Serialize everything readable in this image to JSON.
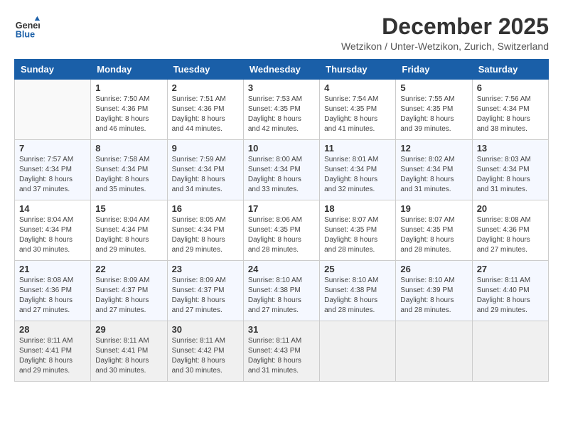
{
  "logo": {
    "general": "General",
    "blue": "Blue"
  },
  "title": "December 2025",
  "location": "Wetzikon / Unter-Wetzikon, Zurich, Switzerland",
  "weekdays": [
    "Sunday",
    "Monday",
    "Tuesday",
    "Wednesday",
    "Thursday",
    "Friday",
    "Saturday"
  ],
  "weeks": [
    [
      {
        "day": "",
        "content": ""
      },
      {
        "day": "1",
        "content": "Sunrise: 7:50 AM\nSunset: 4:36 PM\nDaylight: 8 hours\nand 46 minutes."
      },
      {
        "day": "2",
        "content": "Sunrise: 7:51 AM\nSunset: 4:36 PM\nDaylight: 8 hours\nand 44 minutes."
      },
      {
        "day": "3",
        "content": "Sunrise: 7:53 AM\nSunset: 4:35 PM\nDaylight: 8 hours\nand 42 minutes."
      },
      {
        "day": "4",
        "content": "Sunrise: 7:54 AM\nSunset: 4:35 PM\nDaylight: 8 hours\nand 41 minutes."
      },
      {
        "day": "5",
        "content": "Sunrise: 7:55 AM\nSunset: 4:35 PM\nDaylight: 8 hours\nand 39 minutes."
      },
      {
        "day": "6",
        "content": "Sunrise: 7:56 AM\nSunset: 4:34 PM\nDaylight: 8 hours\nand 38 minutes."
      }
    ],
    [
      {
        "day": "7",
        "content": "Sunrise: 7:57 AM\nSunset: 4:34 PM\nDaylight: 8 hours\nand 37 minutes."
      },
      {
        "day": "8",
        "content": "Sunrise: 7:58 AM\nSunset: 4:34 PM\nDaylight: 8 hours\nand 35 minutes."
      },
      {
        "day": "9",
        "content": "Sunrise: 7:59 AM\nSunset: 4:34 PM\nDaylight: 8 hours\nand 34 minutes."
      },
      {
        "day": "10",
        "content": "Sunrise: 8:00 AM\nSunset: 4:34 PM\nDaylight: 8 hours\nand 33 minutes."
      },
      {
        "day": "11",
        "content": "Sunrise: 8:01 AM\nSunset: 4:34 PM\nDaylight: 8 hours\nand 32 minutes."
      },
      {
        "day": "12",
        "content": "Sunrise: 8:02 AM\nSunset: 4:34 PM\nDaylight: 8 hours\nand 31 minutes."
      },
      {
        "day": "13",
        "content": "Sunrise: 8:03 AM\nSunset: 4:34 PM\nDaylight: 8 hours\nand 31 minutes."
      }
    ],
    [
      {
        "day": "14",
        "content": "Sunrise: 8:04 AM\nSunset: 4:34 PM\nDaylight: 8 hours\nand 30 minutes."
      },
      {
        "day": "15",
        "content": "Sunrise: 8:04 AM\nSunset: 4:34 PM\nDaylight: 8 hours\nand 29 minutes."
      },
      {
        "day": "16",
        "content": "Sunrise: 8:05 AM\nSunset: 4:34 PM\nDaylight: 8 hours\nand 29 minutes."
      },
      {
        "day": "17",
        "content": "Sunrise: 8:06 AM\nSunset: 4:35 PM\nDaylight: 8 hours\nand 28 minutes."
      },
      {
        "day": "18",
        "content": "Sunrise: 8:07 AM\nSunset: 4:35 PM\nDaylight: 8 hours\nand 28 minutes."
      },
      {
        "day": "19",
        "content": "Sunrise: 8:07 AM\nSunset: 4:35 PM\nDaylight: 8 hours\nand 28 minutes."
      },
      {
        "day": "20",
        "content": "Sunrise: 8:08 AM\nSunset: 4:36 PM\nDaylight: 8 hours\nand 27 minutes."
      }
    ],
    [
      {
        "day": "21",
        "content": "Sunrise: 8:08 AM\nSunset: 4:36 PM\nDaylight: 8 hours\nand 27 minutes."
      },
      {
        "day": "22",
        "content": "Sunrise: 8:09 AM\nSunset: 4:37 PM\nDaylight: 8 hours\nand 27 minutes."
      },
      {
        "day": "23",
        "content": "Sunrise: 8:09 AM\nSunset: 4:37 PM\nDaylight: 8 hours\nand 27 minutes."
      },
      {
        "day": "24",
        "content": "Sunrise: 8:10 AM\nSunset: 4:38 PM\nDaylight: 8 hours\nand 27 minutes."
      },
      {
        "day": "25",
        "content": "Sunrise: 8:10 AM\nSunset: 4:38 PM\nDaylight: 8 hours\nand 28 minutes."
      },
      {
        "day": "26",
        "content": "Sunrise: 8:10 AM\nSunset: 4:39 PM\nDaylight: 8 hours\nand 28 minutes."
      },
      {
        "day": "27",
        "content": "Sunrise: 8:11 AM\nSunset: 4:40 PM\nDaylight: 8 hours\nand 29 minutes."
      }
    ],
    [
      {
        "day": "28",
        "content": "Sunrise: 8:11 AM\nSunset: 4:41 PM\nDaylight: 8 hours\nand 29 minutes."
      },
      {
        "day": "29",
        "content": "Sunrise: 8:11 AM\nSunset: 4:41 PM\nDaylight: 8 hours\nand 30 minutes."
      },
      {
        "day": "30",
        "content": "Sunrise: 8:11 AM\nSunset: 4:42 PM\nDaylight: 8 hours\nand 30 minutes."
      },
      {
        "day": "31",
        "content": "Sunrise: 8:11 AM\nSunset: 4:43 PM\nDaylight: 8 hours\nand 31 minutes."
      },
      {
        "day": "",
        "content": ""
      },
      {
        "day": "",
        "content": ""
      },
      {
        "day": "",
        "content": ""
      }
    ]
  ]
}
